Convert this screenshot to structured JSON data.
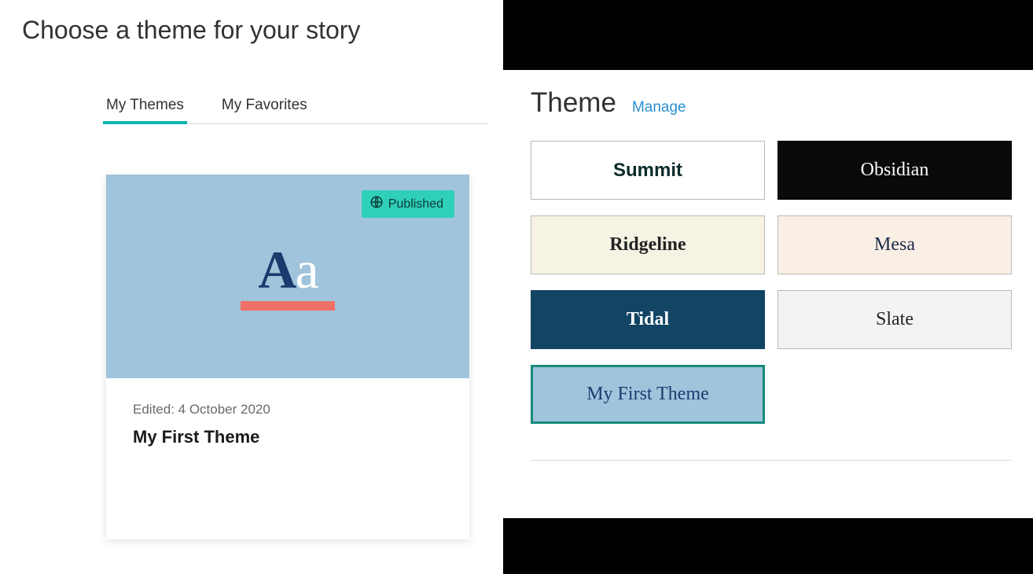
{
  "left": {
    "title": "Choose a theme for your story",
    "tabs": [
      "My Themes",
      "My Favorites"
    ],
    "card": {
      "badge": "Published",
      "edited": "Edited: 4 October 2020",
      "name": "My First Theme"
    }
  },
  "right": {
    "heading": "Theme",
    "manage": "Manage",
    "tiles": {
      "summit": "Summit",
      "obsidian": "Obsidian",
      "ridgeline": "Ridgeline",
      "mesa": "Mesa",
      "tidal": "Tidal",
      "slate": "Slate",
      "custom": "My First Theme"
    }
  }
}
